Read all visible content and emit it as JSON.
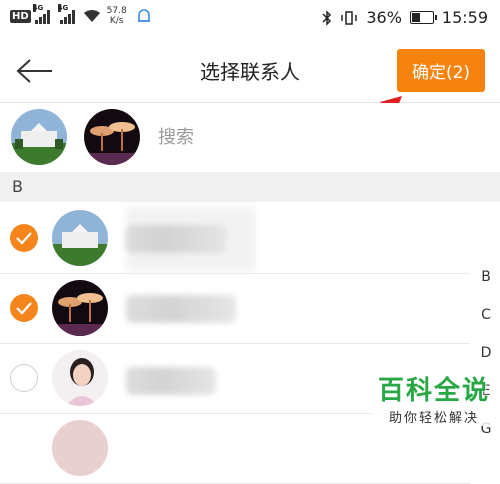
{
  "status_bar": {
    "hd": "HD",
    "net1": "4G",
    "net2": "4G",
    "speed_value": "57.8",
    "speed_unit": "K/s",
    "battery_percent": "36%",
    "battery_level": 0.36,
    "time": "15:59"
  },
  "header": {
    "title": "选择联系人",
    "confirm_label": "确定(2)"
  },
  "selection": {
    "search_placeholder": "搜索"
  },
  "section_letter": "B",
  "contacts": [
    {
      "checked": true
    },
    {
      "checked": true
    },
    {
      "checked": false
    },
    {
      "checked": false
    }
  ],
  "index_letters": [
    "B",
    "C",
    "D",
    "E",
    "G"
  ],
  "watermark": {
    "title": "百科全说",
    "subtitle": "助你轻松解决"
  },
  "colors": {
    "accent": "#f7830f",
    "watermark_green": "#27a844",
    "annotation_red": "#e02020"
  }
}
